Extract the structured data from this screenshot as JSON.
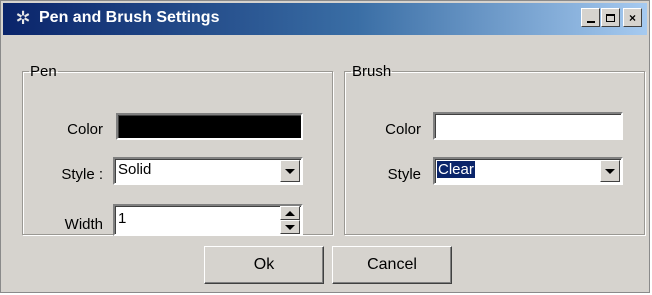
{
  "window": {
    "title": "Pen and Brush Settings",
    "icon": "gear-icon",
    "controls": {
      "minimize": "_",
      "maximize": "□",
      "close": "×"
    }
  },
  "pen": {
    "group_label": "Pen",
    "color_label": "Color",
    "color_value": "#000000",
    "style_label": "Style :",
    "style_value": "Solid",
    "width_label": "Width",
    "width_value": "1"
  },
  "brush": {
    "group_label": "Brush",
    "color_label": "Color",
    "color_value": "#ffffff",
    "style_label": "Style",
    "style_value": "Clear"
  },
  "buttons": {
    "ok_label": "Ok",
    "cancel_label": "Cancel"
  },
  "colors": {
    "dialog_background": "#d6d3ce",
    "titlebar_start": "#0a246a",
    "titlebar_end": "#a6caf0",
    "selection": "#0a246a"
  }
}
